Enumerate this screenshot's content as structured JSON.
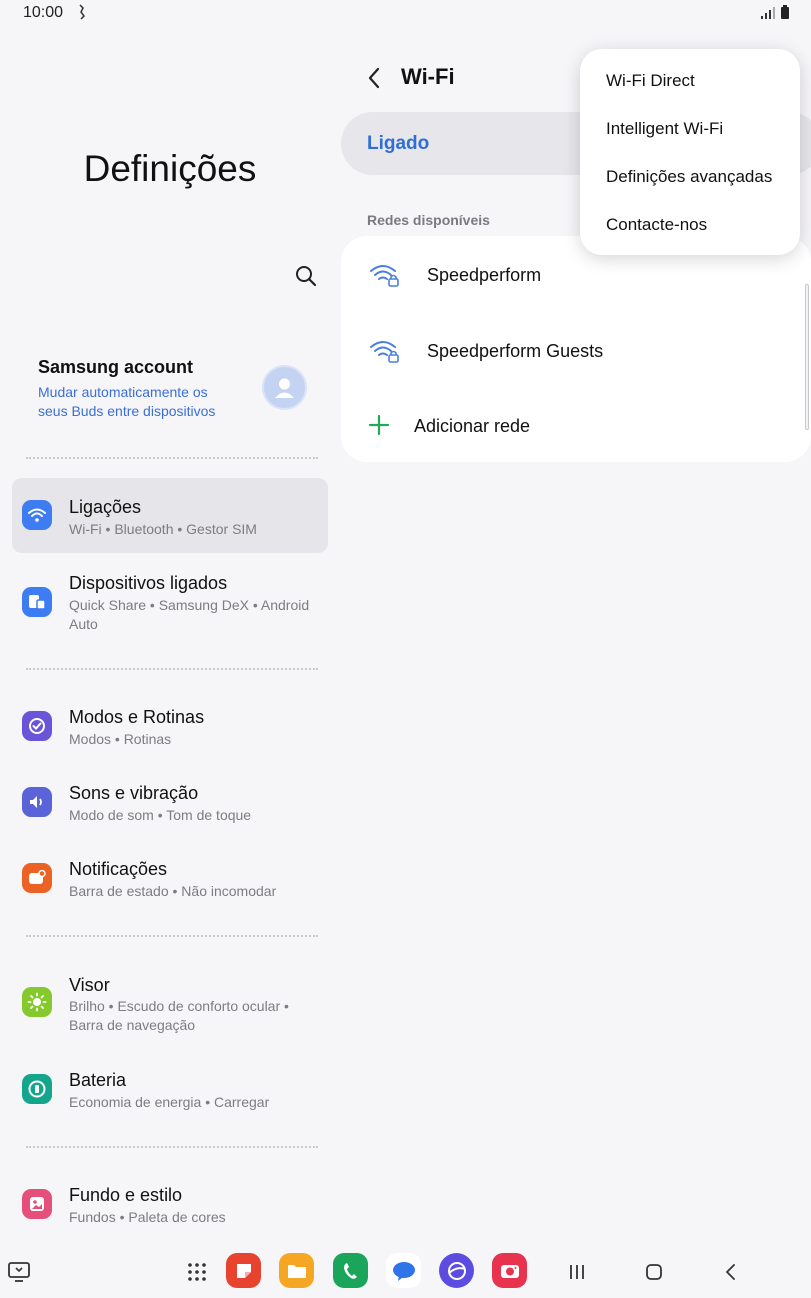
{
  "status_bar": {
    "time": "10:00"
  },
  "settings": {
    "title": "Definições",
    "account": {
      "name": "Samsung account",
      "subtitle": "Mudar automaticamente os seus Buds entre dispositivos"
    },
    "items": [
      {
        "title": "Ligações",
        "subtitle": "Wi-Fi  •  Bluetooth  •  Gestor SIM",
        "icon": "wifi-icon",
        "color": "#3e7cf2",
        "selected": true
      },
      {
        "title": "Dispositivos ligados",
        "subtitle": "Quick Share  •  Samsung DeX  •  Android Auto",
        "icon": "devices-icon",
        "color": "#3e7cf2"
      },
      {
        "title": "Modos e Rotinas",
        "subtitle": "Modos  •  Rotinas",
        "icon": "check-circle-icon",
        "color": "#6a55d8"
      },
      {
        "title": "Sons e vibração",
        "subtitle": "Modo de som  •  Tom de toque",
        "icon": "speaker-icon",
        "color": "#5b63d8"
      },
      {
        "title": "Notificações",
        "subtitle": "Barra de estado  •  Não incomodar",
        "icon": "notification-icon",
        "color": "#ec6124"
      },
      {
        "title": "Visor",
        "subtitle": "Brilho  •  Escudo de conforto ocular  •  Barra de navegação",
        "icon": "sun-icon",
        "color": "#86c92c"
      },
      {
        "title": "Bateria",
        "subtitle": "Economia de energia  •  Carregar",
        "icon": "battery-icon",
        "color": "#14a68c"
      },
      {
        "title": "Fundo e estilo",
        "subtitle": "Fundos  •  Paleta de cores",
        "icon": "wallpaper-icon",
        "color": "#e64f7a"
      }
    ]
  },
  "wifi": {
    "title": "Wi-Fi",
    "toggle_label": "Ligado",
    "toggle_on": true,
    "section_label": "Redes disponíveis",
    "networks": [
      {
        "name": "Speedperform",
        "secured": true
      },
      {
        "name": "Speedperform Guests",
        "secured": true
      }
    ],
    "add_network": "Adicionar rede"
  },
  "popup_menu": {
    "items": [
      "Wi-Fi Direct",
      "Intelligent Wi-Fi",
      "Definições avançadas",
      "Contacte-nos"
    ]
  },
  "nav_bar": {
    "apps": [
      {
        "name": "samsung-notes",
        "color": "#e8432e"
      },
      {
        "name": "my-files",
        "color": "#f5a623"
      },
      {
        "name": "phone",
        "color": "#1aa55a"
      },
      {
        "name": "messages",
        "color": "#2f74e8"
      },
      {
        "name": "internet",
        "color": "#5c4de0"
      },
      {
        "name": "camera",
        "color": "#e8334f"
      }
    ]
  }
}
